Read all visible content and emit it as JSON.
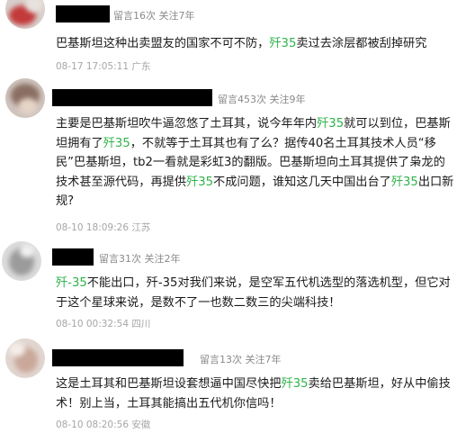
{
  "comments": [
    {
      "meta": "留言16次 关注7年",
      "segments": [
        "巴基斯坦这种出卖盟友的国家不可不防，",
        "歼35",
        "卖过去涂层都被刮掉研究"
      ],
      "time": "08-17 17:05:11 广东"
    },
    {
      "meta": "留言453次 关注9年",
      "segments": [
        "主要是巴基斯坦吹牛逼忽悠了土耳其，说今年年内",
        "歼35",
        "就可以到位，巴基斯坦拥有了",
        "歼35",
        "，不就等于土耳其也有了么？据传40名土耳其技术人员“移民”巴基斯坦，tb2一看就是彩虹3的翻版。巴基斯坦向土耳其提供了枭龙的技术甚至源代码，再提供",
        "歼35",
        "不成问题，谁知这几天中国出台了",
        "歼35",
        "出口新规?"
      ],
      "time": "08-10 18:09:26 江苏"
    },
    {
      "meta": "留言31次 关注2年",
      "segments": [
        "",
        "歼-35",
        "不能出口，歼-35对我们来说，是空军五代机选型的落选机型，但它对于这个星球来说，是数不了一也数二数三的尖端科技！"
      ],
      "time": "08-10 00:32:54 四川"
    },
    {
      "meta": "留言13次 关注7年",
      "segments": [
        "这是土耳其和巴基斯坦设套想逼中国尽快把",
        "歼35",
        "卖给巴基斯坦，好从中偷技术！别上当，土耳其能搞出五代机你信吗！"
      ],
      "time": "08-10 08:20:56 安徽"
    }
  ],
  "colors": {
    "highlight": "#2eb34a",
    "meta": "#8a8a8a",
    "time": "#a6a6a6",
    "text": "#1a1a1a"
  }
}
